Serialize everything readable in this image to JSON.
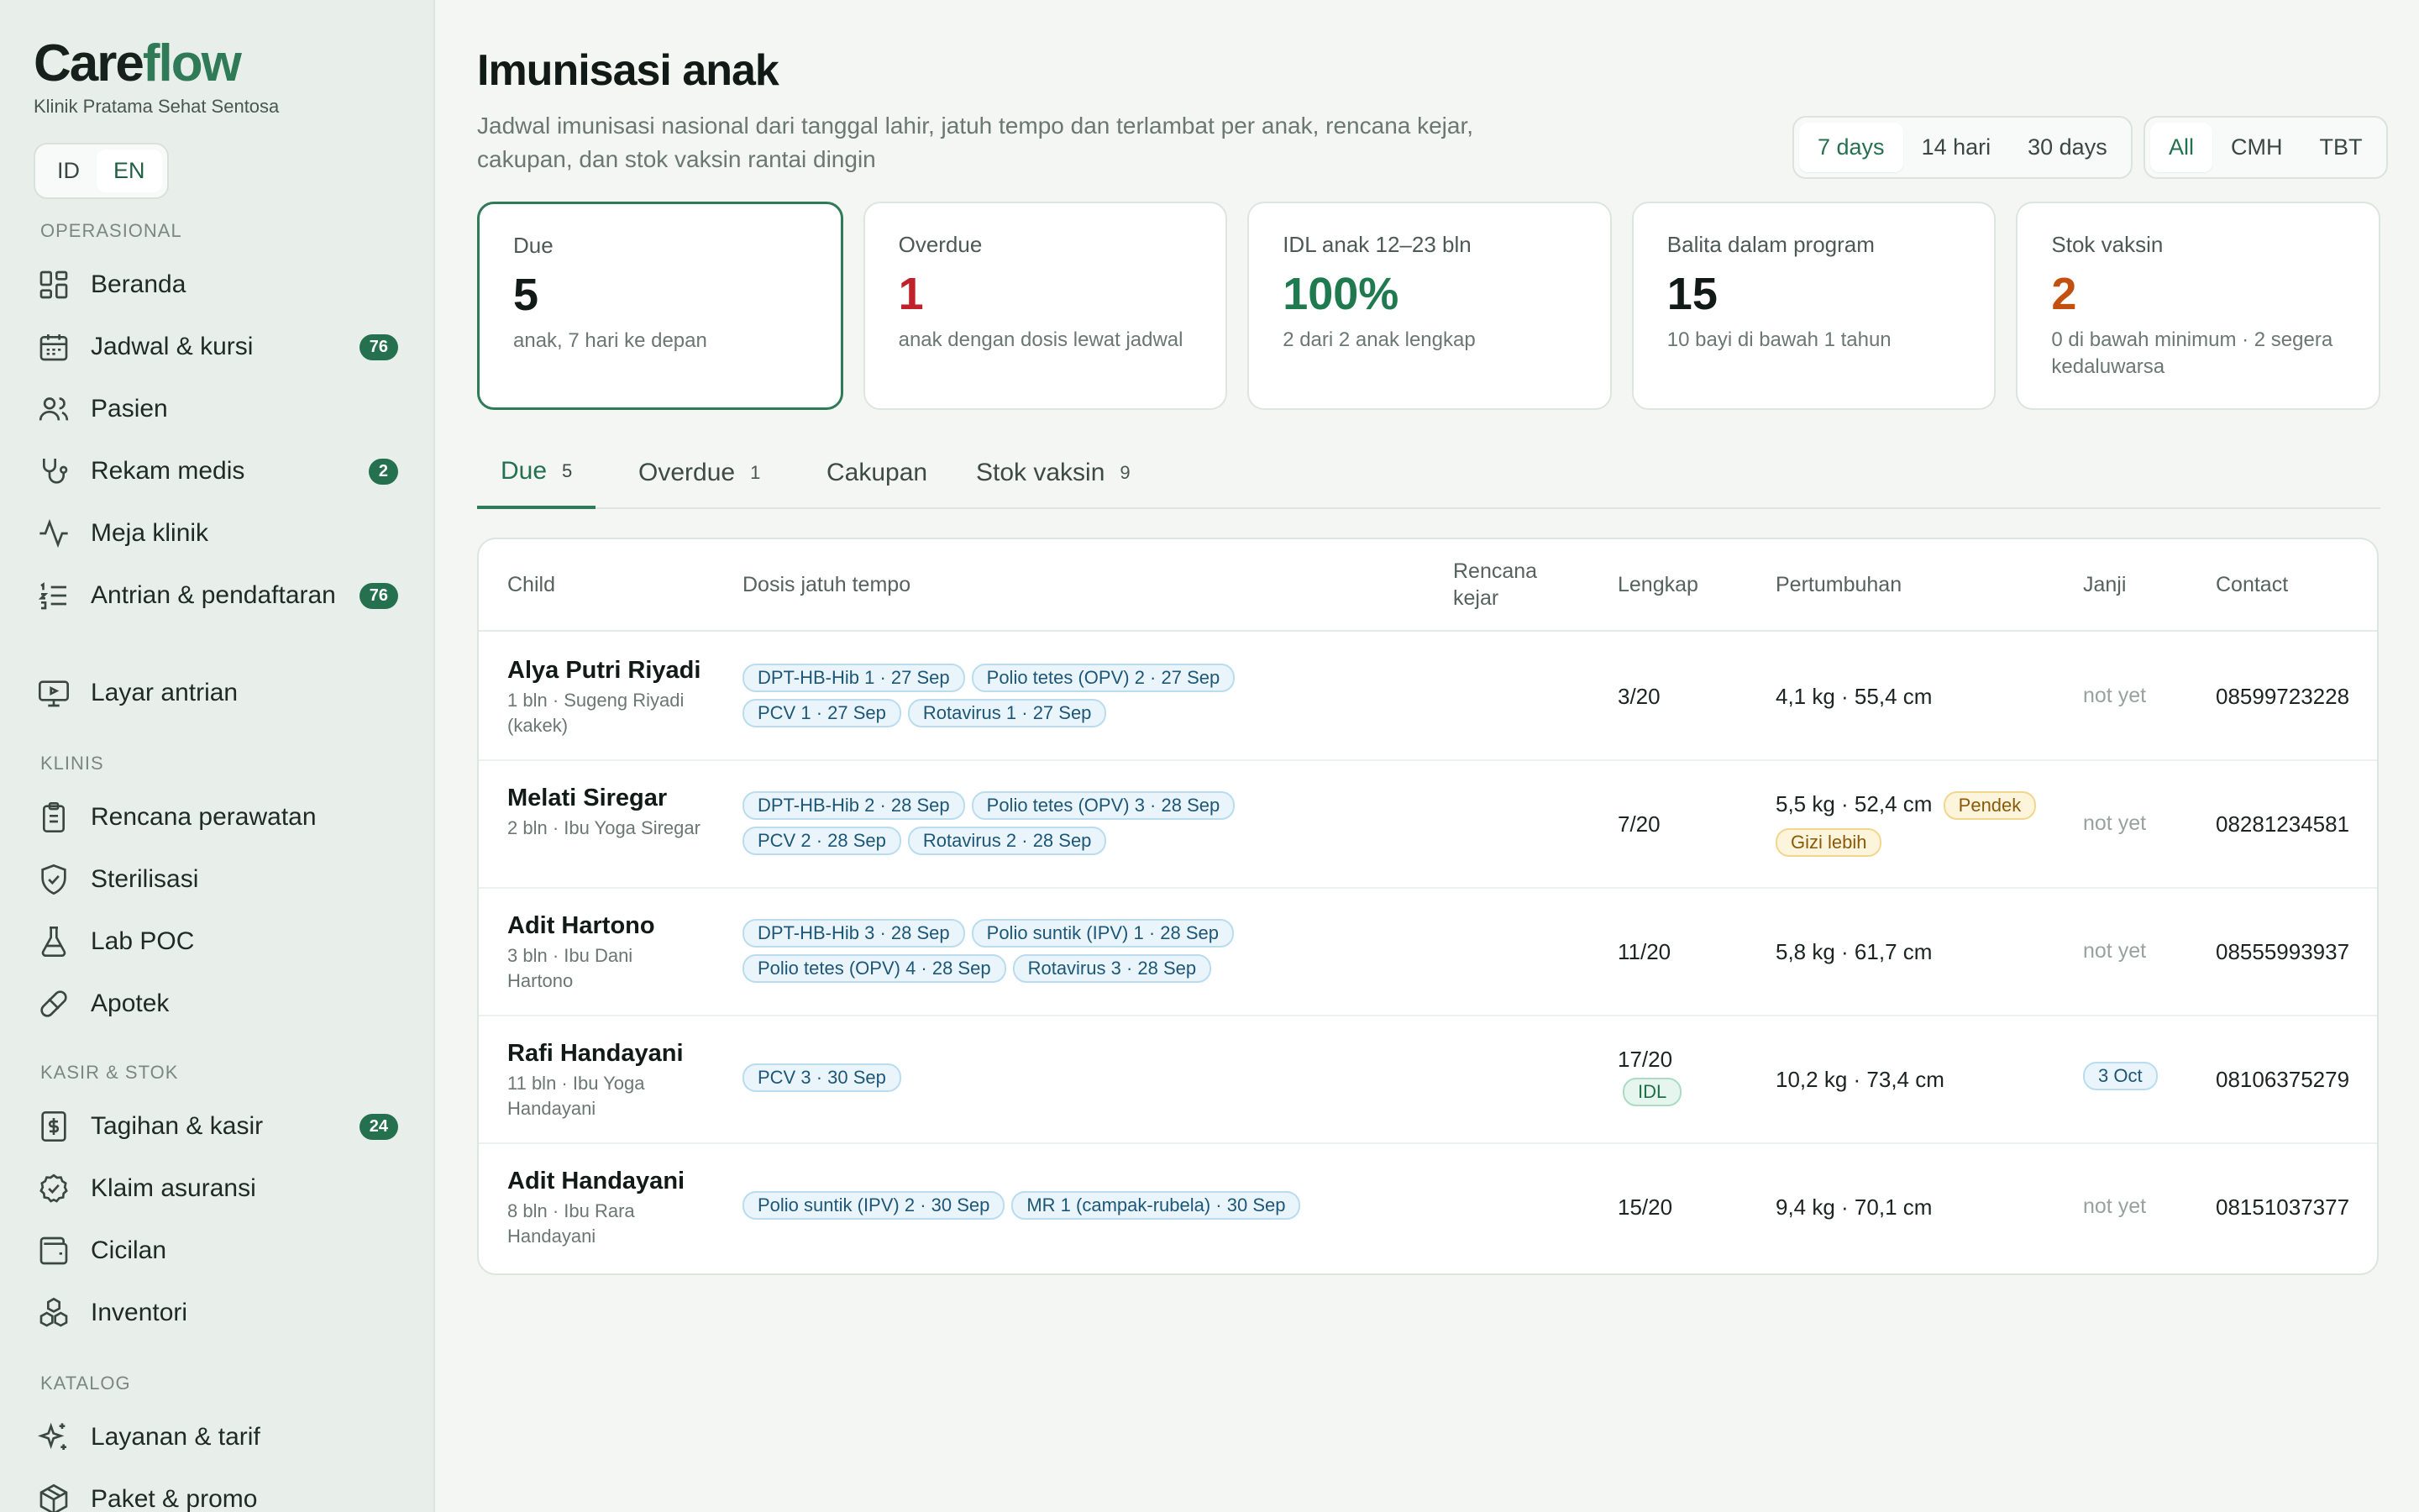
{
  "brand": {
    "name_a": "Care",
    "name_b": "flow",
    "subtitle": "Klinik Pratama Sehat Sentosa"
  },
  "lang": {
    "id": "ID",
    "en": "EN",
    "active": "EN"
  },
  "sidebar": {
    "sections": [
      {
        "label": "OPERASIONAL"
      },
      {
        "label": "KLINIS"
      },
      {
        "label": "KASIR & STOK"
      },
      {
        "label": "KATALOG"
      }
    ],
    "items": [
      {
        "label": "Beranda",
        "icon": "dashboard-icon"
      },
      {
        "label": "Jadwal & kursi",
        "icon": "calendar-icon",
        "badge": "76"
      },
      {
        "label": "Pasien",
        "icon": "users-icon"
      },
      {
        "label": "Rekam medis",
        "icon": "stethoscope-icon",
        "badge": "2"
      },
      {
        "label": "Meja klinik",
        "icon": "activity-icon"
      },
      {
        "label": "Antrian & pendaftaran",
        "icon": "list-icon",
        "badge": "76"
      },
      {
        "label": "Layar antrian",
        "icon": "monitor-icon"
      },
      {
        "label": "Rencana perawatan",
        "icon": "clipboard-icon"
      },
      {
        "label": "Sterilisasi",
        "icon": "shield-icon"
      },
      {
        "label": "Lab POC",
        "icon": "flask-icon"
      },
      {
        "label": "Apotek",
        "icon": "pill-icon"
      },
      {
        "label": "Tagihan & kasir",
        "icon": "receipt-icon",
        "badge": "24"
      },
      {
        "label": "Klaim asuransi",
        "icon": "check-circle-icon"
      },
      {
        "label": "Cicilan",
        "icon": "wallet-icon"
      },
      {
        "label": "Inventori",
        "icon": "boxes-icon"
      },
      {
        "label": "Layanan & tarif",
        "icon": "sparkles-icon"
      },
      {
        "label": "Paket & promo",
        "icon": "package-icon"
      }
    ]
  },
  "page": {
    "title": "Imunisasi anak",
    "description": "Jadwal imunisasi nasional dari tanggal lahir, jatuh tempo dan terlambat per anak, rencana kejar, cakupan, dan stok vaksin rantai dingin"
  },
  "range_filter": {
    "options": [
      "7 days",
      "14 hari",
      "30 days"
    ],
    "selected": "7 days"
  },
  "site_filter": {
    "options": [
      "All",
      "CMH",
      "TBT"
    ],
    "selected": "All"
  },
  "cards": [
    {
      "label": "Due",
      "value": "5",
      "sub": "anak, 7 hari ke depan",
      "color": "#111a17"
    },
    {
      "label": "Overdue",
      "value": "1",
      "sub": "anak dengan dosis lewat jadwal",
      "color": "#c0212b"
    },
    {
      "label": "IDL anak 12–23 bln",
      "value": "100%",
      "sub": "2 dari 2 anak lengkap",
      "color": "#1f7a4f"
    },
    {
      "label": "Balita dalam program",
      "value": "15",
      "sub": "10 bayi di bawah 1 tahun",
      "color": "#111a17"
    },
    {
      "label": "Stok vaksin",
      "value": "2",
      "sub": "0 di bawah minimum · 2 segera kedaluwarsa",
      "color": "#c2510f"
    }
  ],
  "tabs": [
    {
      "label": "Due",
      "count": "5"
    },
    {
      "label": "Overdue",
      "count": "1"
    },
    {
      "label": "Cakupan",
      "count": ""
    },
    {
      "label": "Stok vaksin",
      "count": "9"
    }
  ],
  "table": {
    "headers": {
      "child": "Child",
      "doses": "Dosis jatuh tempo",
      "catchup": "Rencana kejar",
      "complete": "Lengkap",
      "growth": "Pertumbuhan",
      "appt": "Janji",
      "contact": "Contact"
    },
    "rows": [
      {
        "name": "Alya Putri Riyadi",
        "sub": "1 bln · Sugeng Riyadi (kakek)",
        "doses": [
          "DPT-HB-Hib 1 · 27 Sep",
          "Polio tetes (OPV) 2 · 27 Sep",
          "PCV 1 · 27 Sep",
          "Rotavirus 1 · 27 Sep"
        ],
        "complete": "3/20",
        "complete_tag": "",
        "growth": "4,1 kg · 55,4 cm",
        "growth_tags": [],
        "appt": "not yet",
        "contact": "08599723228"
      },
      {
        "name": "Melati Siregar",
        "sub": "2 bln · Ibu Yoga Siregar",
        "doses": [
          "DPT-HB-Hib 2 · 28 Sep",
          "Polio tetes (OPV) 3 · 28 Sep",
          "PCV 2 · 28 Sep",
          "Rotavirus 2 · 28 Sep"
        ],
        "complete": "7/20",
        "complete_tag": "",
        "growth": "5,5 kg · 52,4 cm",
        "growth_tags": [
          "Pendek",
          "Gizi lebih"
        ],
        "appt": "not yet",
        "contact": "08281234581"
      },
      {
        "name": "Adit Hartono",
        "sub": "3 bln · Ibu Dani Hartono",
        "doses": [
          "DPT-HB-Hib 3 · 28 Sep",
          "Polio suntik (IPV) 1 · 28 Sep",
          "Polio tetes (OPV) 4 · 28 Sep",
          "Rotavirus 3 · 28 Sep"
        ],
        "complete": "11/20",
        "complete_tag": "",
        "growth": "5,8 kg · 61,7 cm",
        "growth_tags": [],
        "appt": "not yet",
        "contact": "08555993937"
      },
      {
        "name": "Rafi Handayani",
        "sub": "11 bln · Ibu Yoga Handayani",
        "doses": [
          "PCV 3 · 30 Sep"
        ],
        "complete": "17/20",
        "complete_tag": "IDL",
        "growth": "10,2 kg · 73,4 cm",
        "growth_tags": [],
        "appt": "3 Oct",
        "contact": "08106375279"
      },
      {
        "name": "Adit Handayani",
        "sub": "8 bln · Ibu Rara Handayani",
        "doses": [
          "Polio suntik (IPV) 2 · 30 Sep",
          "MR 1 (campak-rubela) · 30 Sep"
        ],
        "complete": "15/20",
        "complete_tag": "",
        "growth": "9,4 kg · 70,1 cm",
        "growth_tags": [],
        "appt": "not yet",
        "contact": "08151037377"
      }
    ]
  }
}
